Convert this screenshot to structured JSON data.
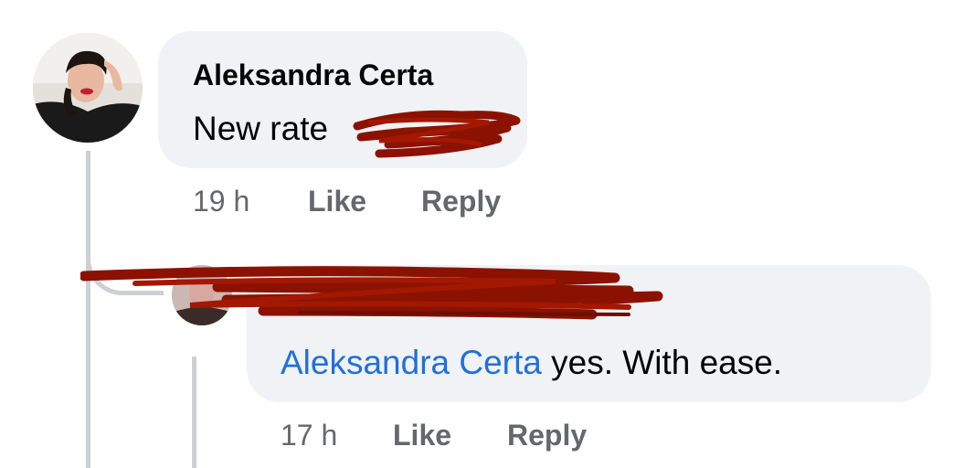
{
  "colors": {
    "bubble_bg": "#f0f2f5",
    "meta_text": "#65676b",
    "mention_link": "#216fdb",
    "redaction": "#8b1200",
    "thread_line": "#ccd0d5"
  },
  "comment": {
    "author": "Aleksandra Certa",
    "text": "New rate",
    "time": "19 h",
    "like_label": "Like",
    "reply_label": "Reply"
  },
  "reply": {
    "mention": "Aleksandra Certa",
    "text": " yes. With ease.",
    "time": "17 h",
    "like_label": "Like",
    "reply_label": "Reply"
  }
}
